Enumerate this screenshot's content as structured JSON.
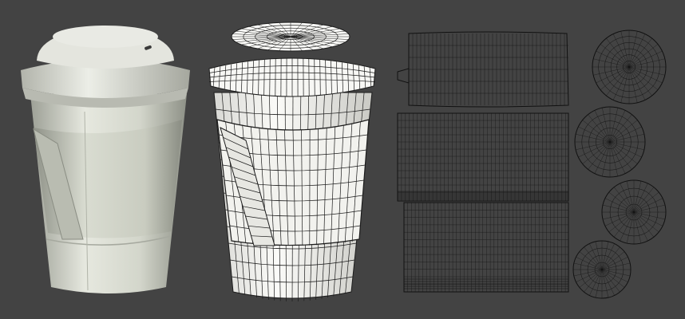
{
  "scene": {
    "background": "#434343",
    "cup_paper": "#d7d9cf",
    "cup_shadow": "#9a9d93",
    "sleeve": "#cdd0c5",
    "lid": "#e2e3dc",
    "wire_surface": "#f4f4f1",
    "wire_line": "#1c1c1c",
    "uv_line": "#111111",
    "panels": [
      {
        "name": "rendered-cup",
        "kind": "render"
      },
      {
        "name": "wireframe-cup",
        "kind": "wireframe"
      },
      {
        "name": "uv-layout",
        "kind": "uv-map"
      }
    ]
  }
}
